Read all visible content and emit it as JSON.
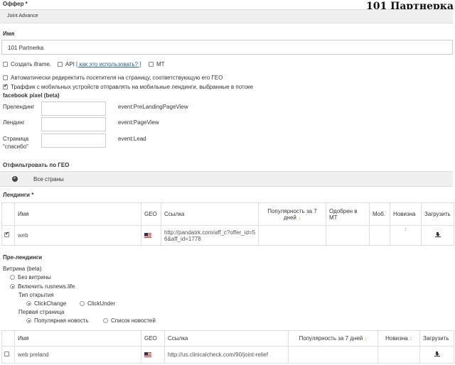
{
  "brand": "101 Партнерка",
  "offer": {
    "label": "Оффер *",
    "value": "Joint Advance"
  },
  "name": {
    "label": "Имя",
    "value": "101 Partnerka"
  },
  "options": {
    "create_iframe": "Создать iframe.",
    "api": "API",
    "api_help": "[ как это использовать? ]",
    "mt": "MT",
    "auto_redirect": "Автоматически редиректить посетителя на страницу, соответствующую его ГЕО",
    "mobile_traffic": "Траффик с мобильных устройств отправлять на мобильные лендинги, выбранные в потоке"
  },
  "facebook": {
    "title": "facebook pixel (beta)",
    "rows": [
      {
        "label": "Прелендинг",
        "event": "event:PreLandingPageView"
      },
      {
        "label": "Лендинг",
        "event": "event:PageView"
      },
      {
        "label": "Страница \"спасибо\"",
        "event": "event:Lead"
      }
    ]
  },
  "geo_filter": {
    "label": "Отфильтровать по ГЕО",
    "value": "Все страны"
  },
  "landings": {
    "title": "Лендинги *",
    "headers": {
      "name": "Имя",
      "geo": "GEO",
      "link": "Ссылка",
      "popularity": "Популярность за 7 дней",
      "approved": "Одобрен в MT",
      "mobile": "Моб.",
      "new": "Новизна",
      "download": "Загрузить"
    },
    "rows": [
      {
        "name": "web",
        "link": "http://pandatrk.com/aff_c?offer_id=56&aff_id=1778",
        "checked": true
      }
    ]
  },
  "prelandings": {
    "title": "Пре-лендинги",
    "showcase_label": "Витрина (beta)",
    "no_showcase": "Без витрины",
    "enable_showcase": "Включить rusnews.life",
    "open_type_label": "Тип открытия",
    "clickchange": "ClickChange",
    "clickunder": "ClickUnder",
    "first_page_label": "Первая страница",
    "popular_news": "Популярная новость",
    "news_list": "Список новостей",
    "headers": {
      "name": "Имя",
      "geo": "GEO",
      "link": "Ссылка",
      "popularity": "Популярность за 7 дней",
      "new": "Новизна",
      "download": "Загрузить"
    },
    "rows": [
      {
        "name": "web preland",
        "link": "http://us.clinicalcheck.com/90/joint-relief"
      }
    ]
  },
  "colors": {
    "accent": "#f0a030",
    "panel": "#efefef",
    "border": "#dddddd"
  }
}
